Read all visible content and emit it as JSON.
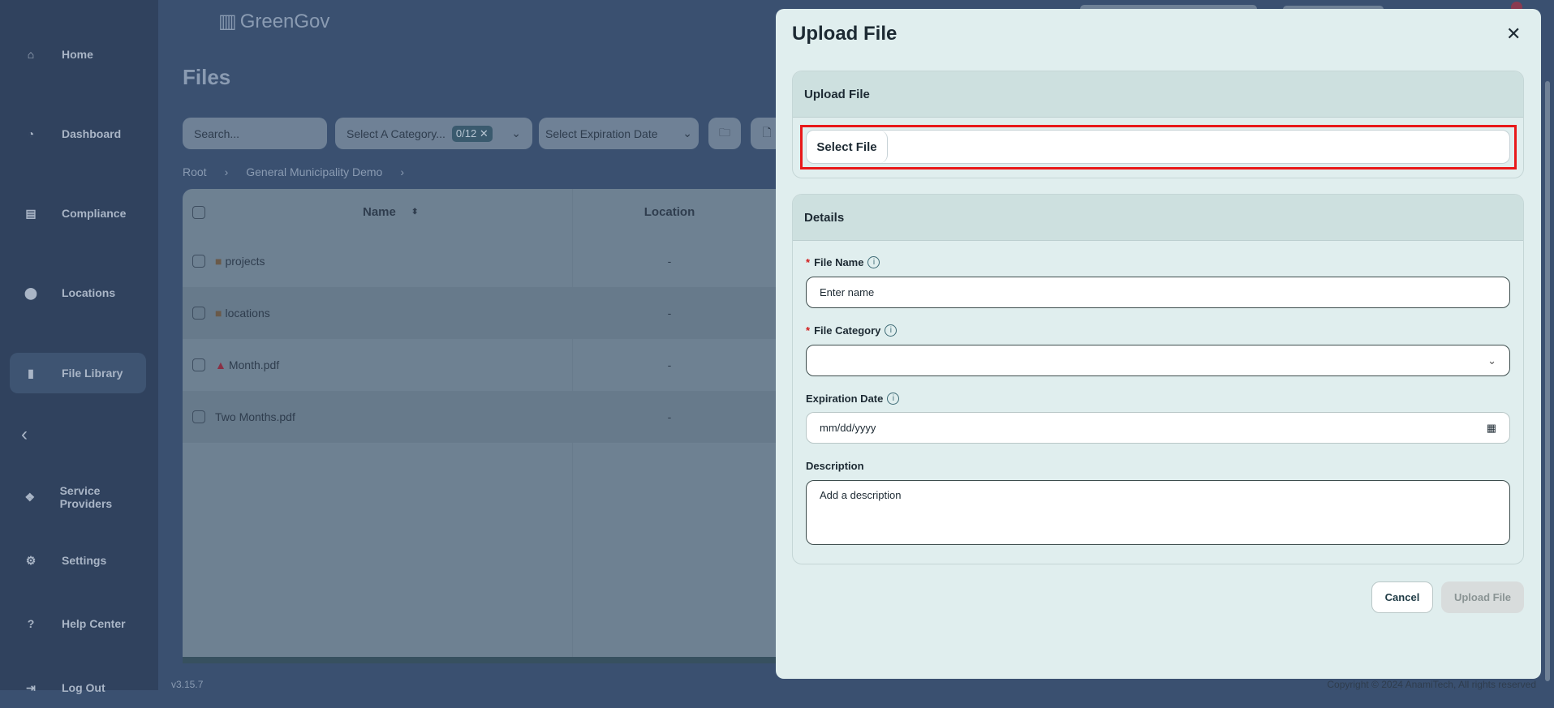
{
  "app": {
    "logo": "GreenGov",
    "version": "v3.15.7",
    "copyright": "Copyright © 2024 AnamiTech, All rights reserved"
  },
  "sidebar": {
    "items": [
      {
        "label": "Home",
        "icon": "home-icon"
      },
      {
        "label": "Dashboard",
        "icon": "pie-chart-icon"
      },
      {
        "label": "Compliance",
        "icon": "inbox-icon"
      },
      {
        "label": "Locations",
        "icon": "map-pin-icon"
      },
      {
        "label": "File Library",
        "icon": "file-icon",
        "active": true
      },
      {
        "label": "Service Providers",
        "icon": "handshake-icon"
      },
      {
        "label": "Settings",
        "icon": "gear-icon"
      },
      {
        "label": "Help Center",
        "icon": "help-icon"
      },
      {
        "label": "Log Out",
        "icon": "logout-icon"
      }
    ]
  },
  "page": {
    "title": "Files",
    "search_placeholder": "Search...",
    "category_placeholder": "Select A Category...",
    "category_badge": "0/12",
    "expiration_placeholder": "Select Expiration Date",
    "breadcrumb": [
      "Root",
      "General Municipality Demo"
    ]
  },
  "table": {
    "headers": {
      "name": "Name",
      "location": "Location"
    },
    "rows": [
      {
        "name": "projects",
        "type": "folder",
        "location": "-"
      },
      {
        "name": "locations",
        "type": "folder",
        "location": "-"
      },
      {
        "name": "Month.pdf",
        "type": "warning",
        "location": "-"
      },
      {
        "name": "Two Months.pdf",
        "type": "file",
        "location": "-"
      }
    ]
  },
  "modal": {
    "title": "Upload File",
    "upload_section": "Upload File",
    "select_file": "Select File",
    "details_section": "Details",
    "file_name_label": "File Name",
    "file_name_placeholder": "Enter name",
    "category_label": "File Category",
    "expiration_label": "Expiration Date",
    "expiration_placeholder": "mm/dd/yyyy",
    "description_label": "Description",
    "description_placeholder": "Add a description",
    "cancel": "Cancel",
    "upload": "Upload File",
    "required_mark": "*",
    "highlight_color": "#e8191a"
  }
}
